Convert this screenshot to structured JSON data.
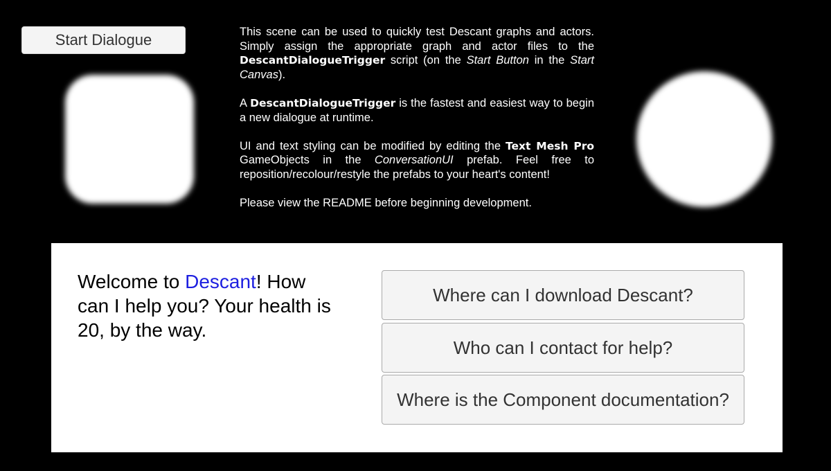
{
  "start_button": {
    "label": "Start Dialogue"
  },
  "info": {
    "p1": {
      "t1": "This scene can be used to quickly test Descant graphs and actors. Simply assign the appropriate graph and actor files to the ",
      "b1": "DescantDialogueTrigger",
      "t2": " script (on the ",
      "i1": "Start Button",
      "t3": " in the ",
      "i2": "Start Canvas",
      "t4": ")."
    },
    "p2": {
      "t1": "A ",
      "b1": "DescantDialogueTrigger",
      "t2": " is the fastest and easiest way to begin a new dialogue at runtime."
    },
    "p3": {
      "t1": "UI and text styling can be modified by editing the ",
      "b1": "Text Mesh Pro",
      "t2": " GameObjects in the ",
      "i1": "ConversationUI",
      "t3": " prefab. Feel free to reposition/recolour/restyle the prefabs to your heart's content!"
    },
    "p4": "Please view the README before beginning development."
  },
  "dialogue": {
    "text_before": "Welcome to ",
    "highlight": "Descant",
    "text_after": "! How can I help you? Your health is 20, by the way.",
    "highlight_color": "#1d1fe0",
    "choices": [
      "Where can I download Descant?",
      "Who can I contact for help?",
      "Where is the Component documentation?"
    ]
  }
}
